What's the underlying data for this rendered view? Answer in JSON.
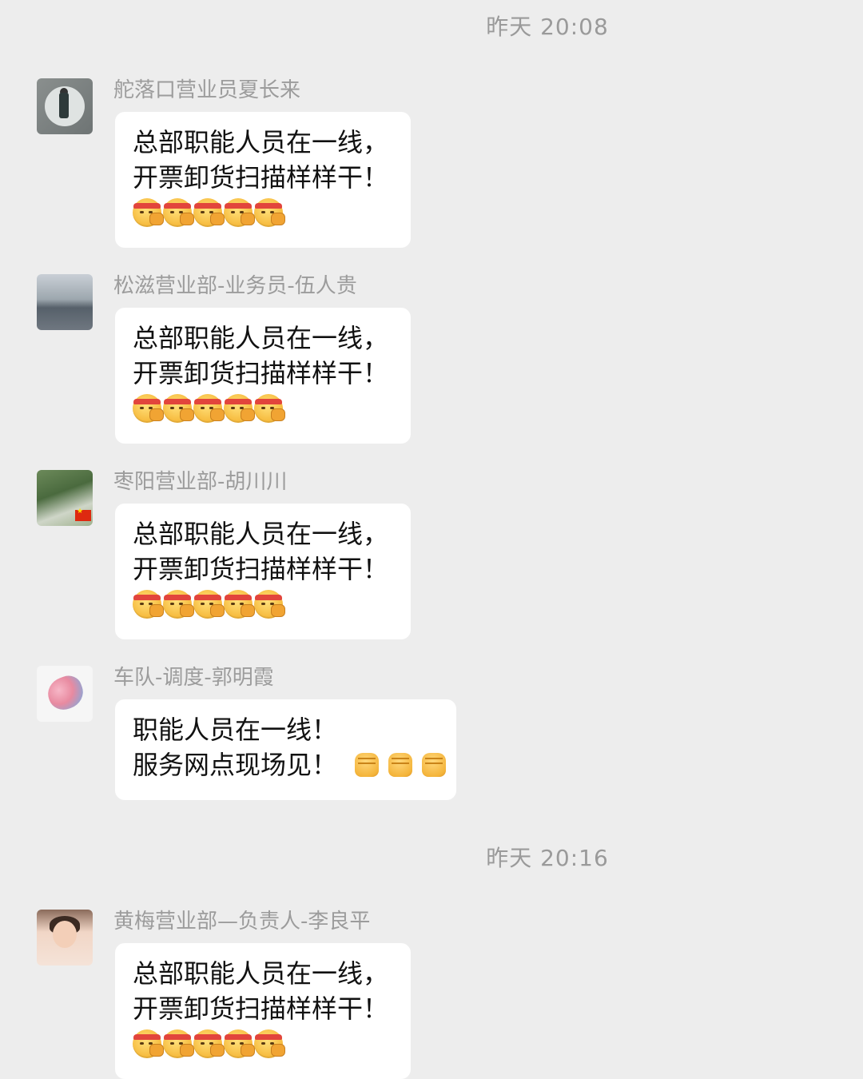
{
  "timestamps": [
    "昨天 20:08",
    "昨天 20:16"
  ],
  "messages": [
    {
      "sender": "舵落口营业员夏长来",
      "lines": [
        "总部职能人员在一线，",
        "开票卸货扫描样样干！"
      ],
      "emoji": "fist-headband-emoji",
      "emoji_count": 5
    },
    {
      "sender": "松滋营业部-业务员-伍人贵",
      "lines": [
        "总部职能人员在一线，",
        "开票卸货扫描样样干！"
      ],
      "emoji": "fist-headband-emoji",
      "emoji_count": 5
    },
    {
      "sender": "枣阳营业部-胡川川",
      "lines": [
        "总部职能人员在一线，",
        "开票卸货扫描样样干！"
      ],
      "emoji": "fist-headband-emoji",
      "emoji_count": 5
    },
    {
      "sender": "车队-调度-郭明霞",
      "lines": [
        "职能人员在一线！",
        "服务网点现场见！"
      ],
      "emoji": "raised-fist-emoji",
      "emoji_count": 3
    },
    {
      "sender": "黄梅营业部—负责人-李良平",
      "lines": [
        "总部职能人员在一线，",
        "开票卸货扫描样样干！"
      ],
      "emoji": "fist-headband-emoji",
      "emoji_count": 5
    }
  ],
  "colors": {
    "background": "#ededed",
    "bubble": "#ffffff",
    "meta_text": "#9c9c9c"
  }
}
